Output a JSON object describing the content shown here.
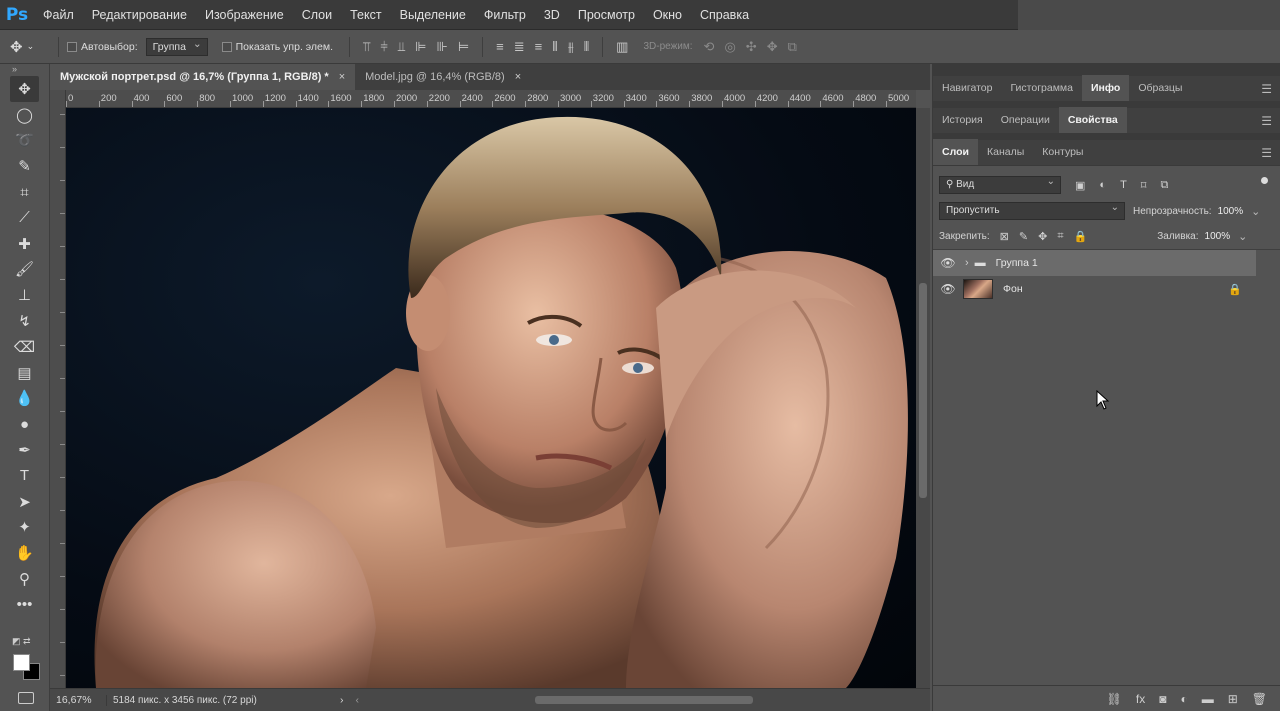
{
  "app": {
    "logo": "Ps"
  },
  "menu": [
    "Файл",
    "Редактирование",
    "Изображение",
    "Слои",
    "Текст",
    "Выделение",
    "Фильтр",
    "3D",
    "Просмотр",
    "Окно",
    "Справка"
  ],
  "options": {
    "autoselect_label": "Автовыбор:",
    "autoselect_value": "Группа",
    "show_controls_label": "Показать упр. элем.",
    "mode3d_label": "3D-режим:"
  },
  "doc_tabs": [
    {
      "label": "Мужской портрет.psd @ 16,7% (Группа 1, RGB/8) *",
      "close": "×"
    },
    {
      "label": "Model.jpg @ 16,4% (RGB/8)",
      "close": "×"
    }
  ],
  "ruler_labels": [
    "0",
    "200",
    "400",
    "600",
    "800",
    "1000",
    "1200",
    "1400",
    "1600",
    "1800",
    "2000",
    "2200",
    "2400",
    "2600",
    "2800",
    "3000",
    "3200",
    "3400",
    "3600",
    "3800",
    "4000",
    "4200",
    "4400",
    "4600",
    "4800",
    "5000"
  ],
  "status": {
    "zoom": "16,67%",
    "info": "5184 пикс. x 3456 пикс. (72 ppi)"
  },
  "panels": {
    "row1": [
      "Навигатор",
      "Гистограмма",
      "Инфо",
      "Образцы"
    ],
    "row2": [
      "История",
      "Операции",
      "Свойства"
    ],
    "row3": [
      "Слои",
      "Каналы",
      "Контуры"
    ]
  },
  "layers_panel": {
    "filter_kind": "Вид",
    "blend_mode": "Пропустить",
    "opacity_label": "Непрозрачность:",
    "opacity_value": "100%",
    "lock_label": "Закрепить:",
    "fill_label": "Заливка:",
    "fill_value": "100%",
    "layers": [
      {
        "name": "Группа 1",
        "type": "group",
        "selected": true
      },
      {
        "name": "Фон",
        "type": "image",
        "locked": true
      }
    ]
  }
}
